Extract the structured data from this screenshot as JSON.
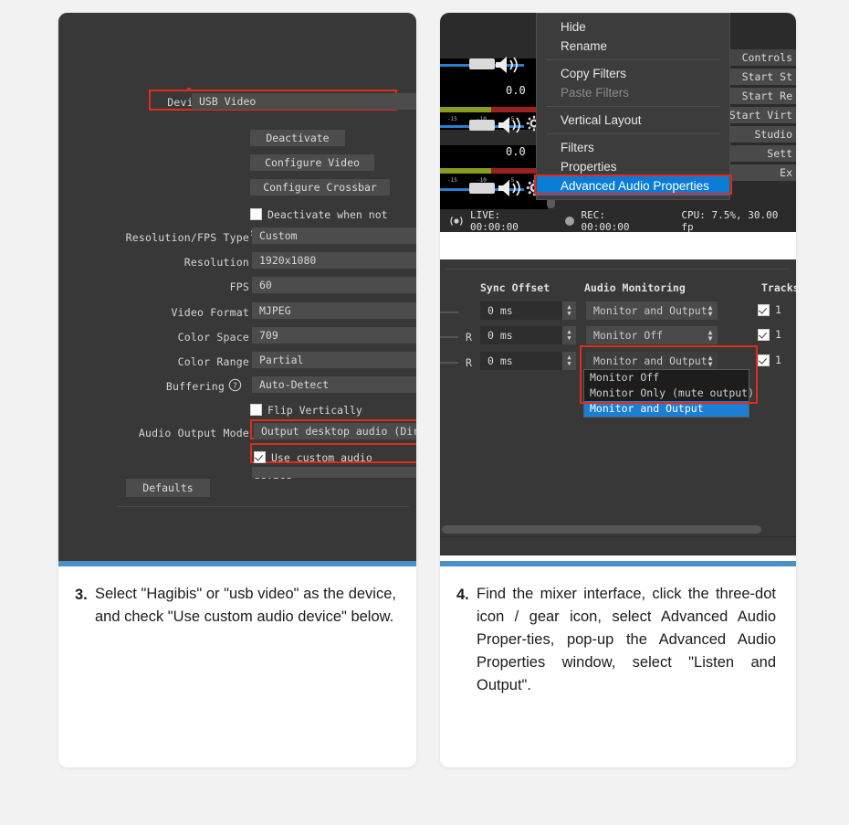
{
  "left_panel": {
    "device_row": {
      "label": "Device",
      "value": "USB Video"
    },
    "buttons": [
      "Deactivate",
      "Configure Video",
      "Configure Crossbar"
    ],
    "deactivate_checkbox": {
      "label": "Deactivate when not showing",
      "checked": false
    },
    "fields": [
      {
        "label": "Resolution/FPS Type",
        "value": "Custom"
      },
      {
        "label": "Resolution",
        "value": "1920x1080"
      },
      {
        "label": "FPS",
        "value": "60"
      },
      {
        "label": "Video Format",
        "value": "MJPEG"
      },
      {
        "label": "Color Space",
        "value": "709"
      },
      {
        "label": "Color Range",
        "value": "Partial"
      },
      {
        "label": "Buffering",
        "value": "Auto-Detect",
        "help_icon": "question-mark-icon"
      }
    ],
    "flip_checkbox": {
      "label": "Flip Vertically",
      "checked": false
    },
    "audio_output_mode": {
      "label": "Audio Output Mode",
      "value": "Output desktop audio (DirectSound)"
    },
    "custom_audio_checkbox": {
      "label": "Use custom audio device",
      "checked": true
    },
    "defaults_button": "Defaults"
  },
  "right_panel": {
    "context_menu": {
      "items": [
        {
          "label": "Hide",
          "state": "normal"
        },
        {
          "label": "Rename",
          "state": "normal"
        },
        {
          "sep": true
        },
        {
          "label": "Copy Filters",
          "state": "normal"
        },
        {
          "label": "Paste Filters",
          "state": "disabled"
        },
        {
          "sep": true
        },
        {
          "label": "Vertical Layout",
          "state": "normal"
        },
        {
          "sep": true
        },
        {
          "label": "Filters",
          "state": "normal"
        },
        {
          "label": "Properties",
          "state": "normal"
        },
        {
          "label": "Advanced Audio Properties",
          "state": "selected"
        }
      ]
    },
    "mixer": {
      "volume_values": [
        "0.0",
        "0.0"
      ],
      "meter_ticks": [
        "-15",
        "-10",
        "-5"
      ],
      "speaker_icon": "speaker-icon",
      "gear_icon": "gear-icon"
    },
    "status_bar": {
      "live_icon": "broadcast-icon",
      "live_label": "LIVE: 00:00:00",
      "rec_icon": "record-dot-icon",
      "rec_label": "REC: 00:00:00",
      "cpu_label": "CPU: 7.5%, 30.00 fp"
    },
    "controls": {
      "title": "Controls",
      "buttons": [
        "Start St",
        "Start Re",
        "Start Virt",
        "Studio",
        "Sett",
        "Ex"
      ]
    },
    "advanced_audio": {
      "headers": {
        "sync_offset": "Sync Offset",
        "audio_monitoring": "Audio Monitoring",
        "tracks": "Tracks"
      },
      "rows": [
        {
          "balance": "",
          "sync": "0 ms",
          "monitoring": "Monitor and Output",
          "track_checked": true,
          "track_label": "1"
        },
        {
          "balance": "R",
          "sync": "0 ms",
          "monitoring": "Monitor Off",
          "track_checked": true,
          "track_label": "1"
        },
        {
          "balance": "R",
          "sync": "0 ms",
          "monitoring": "Monitor and Output",
          "track_checked": true,
          "track_label": "1"
        }
      ],
      "dropdown_options": [
        {
          "label": "Monitor Off",
          "selected": false
        },
        {
          "label": "Monitor Only (mute output)",
          "selected": false
        },
        {
          "label": "Monitor and Output",
          "selected": true
        }
      ]
    }
  },
  "captions": {
    "step3": {
      "number": "3.",
      "text": "Select \"Hagibis\" or \"usb video\" as the device, and check \"Use custom audio device\" below."
    },
    "step4": {
      "number": "4.",
      "text": "Find the mixer interface, click the three-dot icon / gear icon, select Advanced Audio Proper-ties, pop-up the Advanced Audio Properties window, select \"Listen and Output\"."
    }
  },
  "colors": {
    "accent_blue": "#4a90c4",
    "highlight_red": "#e02b1d",
    "selection_blue": "#0a7cd6",
    "panel_dark": "#383838",
    "page_bg": "#f2f2f2"
  }
}
